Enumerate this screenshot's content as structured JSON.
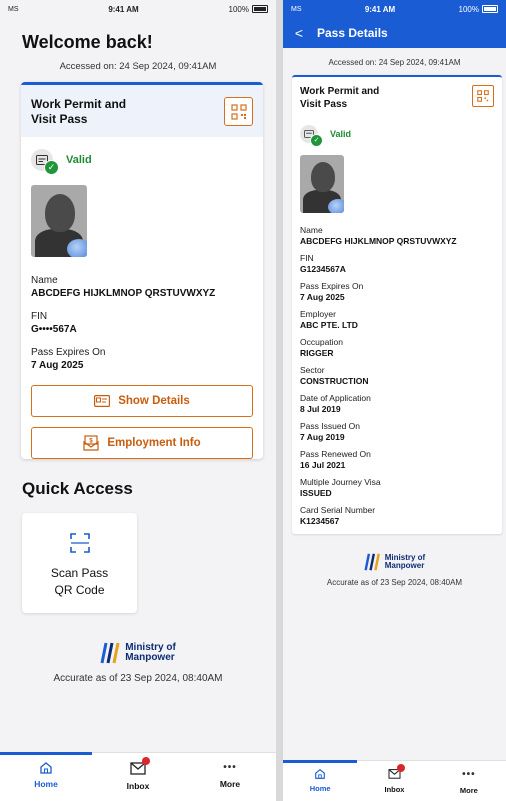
{
  "status_bar": {
    "carrier": "MS",
    "time": "9:41 AM",
    "battery": "100%"
  },
  "home": {
    "welcome_title": "Welcome back!",
    "accessed": "Accessed on: 24 Sep 2024, 09:41AM",
    "pass_card": {
      "title": "Work Permit and Visit Pass",
      "status": "Valid",
      "fields": [
        {
          "label": "Name",
          "value": "ABCDEFG HIJKLMNOP QRSTUVWXYZ"
        },
        {
          "label": "FIN",
          "value": "G••••567A"
        },
        {
          "label": "Pass Expires On",
          "value": "7 Aug 2025"
        }
      ],
      "show_details_label": "Show Details",
      "employment_info_label": "Employment Info"
    },
    "quick_access": {
      "title": "Quick Access",
      "scan_label_line1": "Scan Pass",
      "scan_label_line2": "QR Code"
    },
    "logo_line1": "Ministry of",
    "logo_line2": "Manpower",
    "accurate": "Accurate as of 23 Sep 2024, 08:40AM"
  },
  "details": {
    "nav_title": "Pass Details",
    "accessed": "Accessed on: 24 Sep 2024, 09:41AM",
    "card_title": "Work Permit and Visit Pass",
    "status": "Valid",
    "fields": [
      {
        "label": "Name",
        "value": "ABCDEFG HIJKLMNOP QRSTUVWXYZ"
      },
      {
        "label": "FIN",
        "value": "G1234567A"
      },
      {
        "label": "Pass Expires On",
        "value": "7 Aug 2025"
      },
      {
        "label": "Employer",
        "value": "ABC PTE. LTD"
      },
      {
        "label": "Occupation",
        "value": "RIGGER"
      },
      {
        "label": "Sector",
        "value": "CONSTRUCTION"
      },
      {
        "label": "Date of Application",
        "value": "8 Jul 2019"
      },
      {
        "label": "Pass Issued On",
        "value": "7 Aug 2019"
      },
      {
        "label": "Pass Renewed On",
        "value": "16 Jul 2021"
      },
      {
        "label": "Multiple Journey Visa",
        "value": "ISSUED"
      },
      {
        "label": "Card Serial Number",
        "value": "K1234567"
      }
    ],
    "logo_line1": "Ministry of",
    "logo_line2": "Manpower",
    "accurate": "Accurate as of 23 Sep 2024, 08:40AM"
  },
  "tabs": [
    {
      "label": "Home",
      "icon": "home-icon"
    },
    {
      "label": "Inbox",
      "icon": "inbox-icon"
    },
    {
      "label": "More",
      "icon": "more-icon"
    }
  ],
  "colors": {
    "accent": "#1a5cd4",
    "button_orange": "#d86e1a",
    "valid_green": "#1f8a32"
  }
}
